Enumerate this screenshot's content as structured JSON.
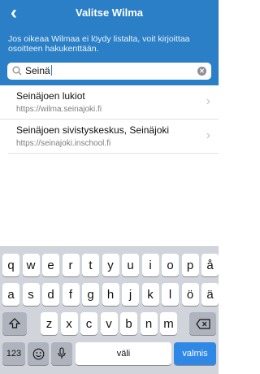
{
  "nav": {
    "title": "Valitse Wilma",
    "back_icon": "chevron-left-icon"
  },
  "hint": "Jos oikeaa Wilmaa ei löydy listalta, voit kirjoittaa osoitteen hakukenttään.",
  "search": {
    "value": "Seinä",
    "clear_icon": "clear-circle-icon",
    "search_icon": "search-icon"
  },
  "results": [
    {
      "name": "Seinäjoen lukiot",
      "url": "https://wilma.seinajoki.fi"
    },
    {
      "name": "Seinäjoen sivistyskeskus, Seinäjoki",
      "url": "https://seinajoki.inschool.fi"
    }
  ],
  "keyboard": {
    "row1": [
      "q",
      "w",
      "e",
      "r",
      "t",
      "y",
      "u",
      "i",
      "o",
      "p",
      "å"
    ],
    "row2": [
      "a",
      "s",
      "d",
      "f",
      "g",
      "h",
      "j",
      "k",
      "l",
      "ö",
      "ä"
    ],
    "row3": [
      "z",
      "x",
      "c",
      "v",
      "b",
      "n",
      "m"
    ],
    "numbers_label": "123",
    "space_label": "väli",
    "done_label": "valmis"
  },
  "colors": {
    "header": "#2a7fc6",
    "done_key": "#2f87e6",
    "keyboard_bg": "#d1d4da"
  }
}
